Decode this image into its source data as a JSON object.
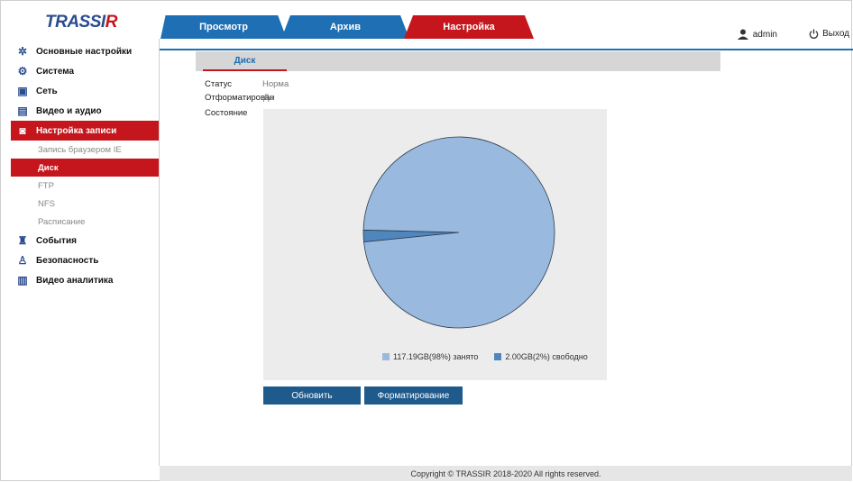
{
  "brand": {
    "logo_main": "TRASSI",
    "logo_accent": "R"
  },
  "topnav": {
    "tabs": [
      {
        "label": "Просмотр"
      },
      {
        "label": "Архив"
      },
      {
        "label": "Настройка"
      }
    ],
    "user": "admin",
    "logout": "Выход"
  },
  "sidebar": {
    "items": [
      {
        "label": "Основные настройки",
        "icon": "gear-icon"
      },
      {
        "label": "Система",
        "icon": "gears-icon"
      },
      {
        "label": "Сеть",
        "icon": "network-icon"
      },
      {
        "label": "Видео и аудио",
        "icon": "clapper-icon"
      },
      {
        "label": "Настройка записи",
        "icon": "record-icon"
      },
      {
        "label": "События",
        "icon": "event-icon"
      },
      {
        "label": "Безопасность",
        "icon": "user-security-icon"
      },
      {
        "label": "Видео аналитика",
        "icon": "analytics-icon"
      }
    ],
    "subitems": [
      {
        "label": "Запись браузером IE"
      },
      {
        "label": "Диск"
      },
      {
        "label": "FTP"
      },
      {
        "label": "NFS"
      },
      {
        "label": "Расписание"
      }
    ]
  },
  "main": {
    "tab": "Диск",
    "status_label": "Статус",
    "status_value": "Норма",
    "formatted_label": "Отформатирован",
    "formatted_value": "Да",
    "state_label": "Состояние",
    "refresh_button": "Обновить",
    "format_button": "Форматирование"
  },
  "chart_data": {
    "type": "pie",
    "slices": [
      {
        "label": "117.19GB(98%) занято",
        "value": 98,
        "color": "#99b9df"
      },
      {
        "label": "2.00GB(2%) свободно",
        "value": 2,
        "color": "#4f86be"
      }
    ]
  },
  "footer": "Copyright © TRASSIR 2018-2020 All rights reserved."
}
